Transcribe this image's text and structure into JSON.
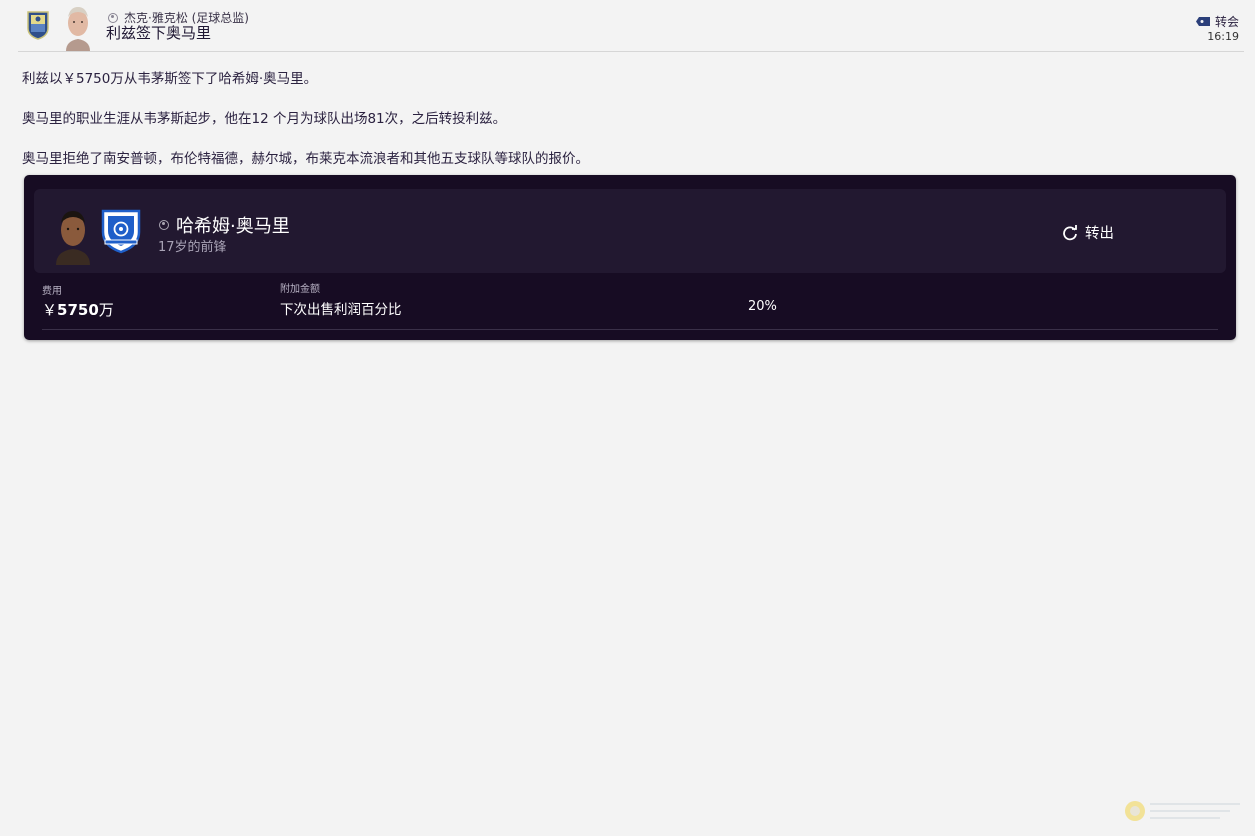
{
  "header": {
    "author": "杰克·雅克松 (足球总监)",
    "title": "利兹签下奥马里",
    "category": "转会",
    "time": "16:19"
  },
  "article": {
    "paragraphs": [
      "利兹以￥5750万从韦茅斯签下了哈希姆·奥马里。",
      "奥马里的职业生涯从韦茅斯起步，他在12 个月为球队出场81次，之后转投利兹。",
      "奥马里拒绝了南安普顿，布伦特福德，赫尔城，布莱克本流浪者和其他五支球队等球队的报价。"
    ]
  },
  "transfer_card": {
    "player_name": "哈希姆·奥马里",
    "player_sub": "17岁的前锋",
    "action_label": "转出",
    "fee_label": "费用",
    "fee_currency": "￥",
    "fee_value": "5750",
    "fee_unit": "万",
    "addon_label": "附加金额",
    "addon_name": "下次出售利润百分比",
    "addon_value": "20%"
  },
  "icons": {
    "author_icon": "person-icon",
    "category_icon": "tag-icon",
    "action_icon": "refresh-icon"
  },
  "colors": {
    "page_bg": "#f3f3f3",
    "card_bg": "#170c23",
    "card_inner_bg": "#221830",
    "shield_blue": "#1f5fc9"
  }
}
